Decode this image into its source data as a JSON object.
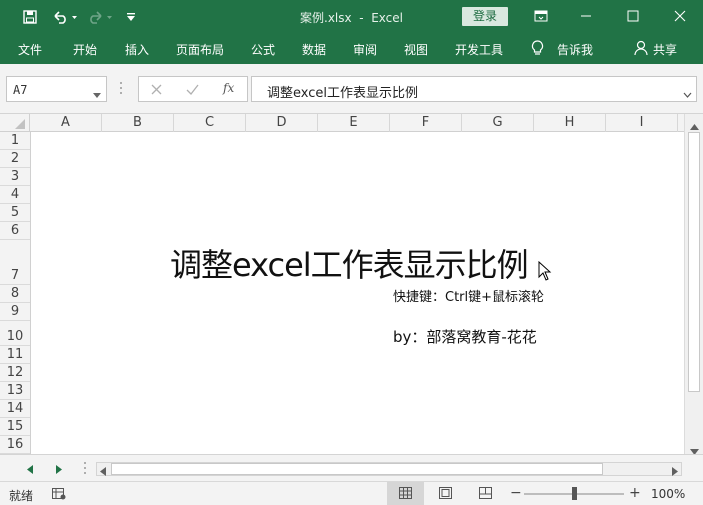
{
  "titlebar": {
    "title": "案例.xlsx  -  Excel",
    "login_label": "登录",
    "quick_access": [
      "save-icon",
      "undo-icon",
      "redo-icon",
      "customize-icon"
    ]
  },
  "ribbon": {
    "tabs": [
      "文件",
      "开始",
      "插入",
      "页面布局",
      "公式",
      "数据",
      "审阅",
      "视图",
      "开发工具"
    ],
    "tell_me": "告诉我",
    "share": "共享"
  },
  "formula_bar": {
    "name_box": "A7",
    "fx_label": "fx",
    "formula": "调整excel工作表显示比例"
  },
  "grid": {
    "columns": [
      "A",
      "B",
      "C",
      "D",
      "E",
      "F",
      "G",
      "H",
      "I"
    ],
    "rows": [
      "1",
      "2",
      "3",
      "4",
      "5",
      "6",
      "7",
      "8",
      "9",
      "10",
      "11",
      "12",
      "13",
      "14",
      "15",
      "16"
    ]
  },
  "cells": {
    "a7": "调整excel工作表显示比例",
    "f8": "快捷键：Ctrl键+鼠标滚轮",
    "f10": "by：部落窝教育-花花"
  },
  "statusbar": {
    "status": "就绪",
    "zoom": "100%",
    "zoom_fraction": 0.5
  },
  "colors": {
    "brand": "#217346",
    "header_bg": "#f3f3f3"
  }
}
